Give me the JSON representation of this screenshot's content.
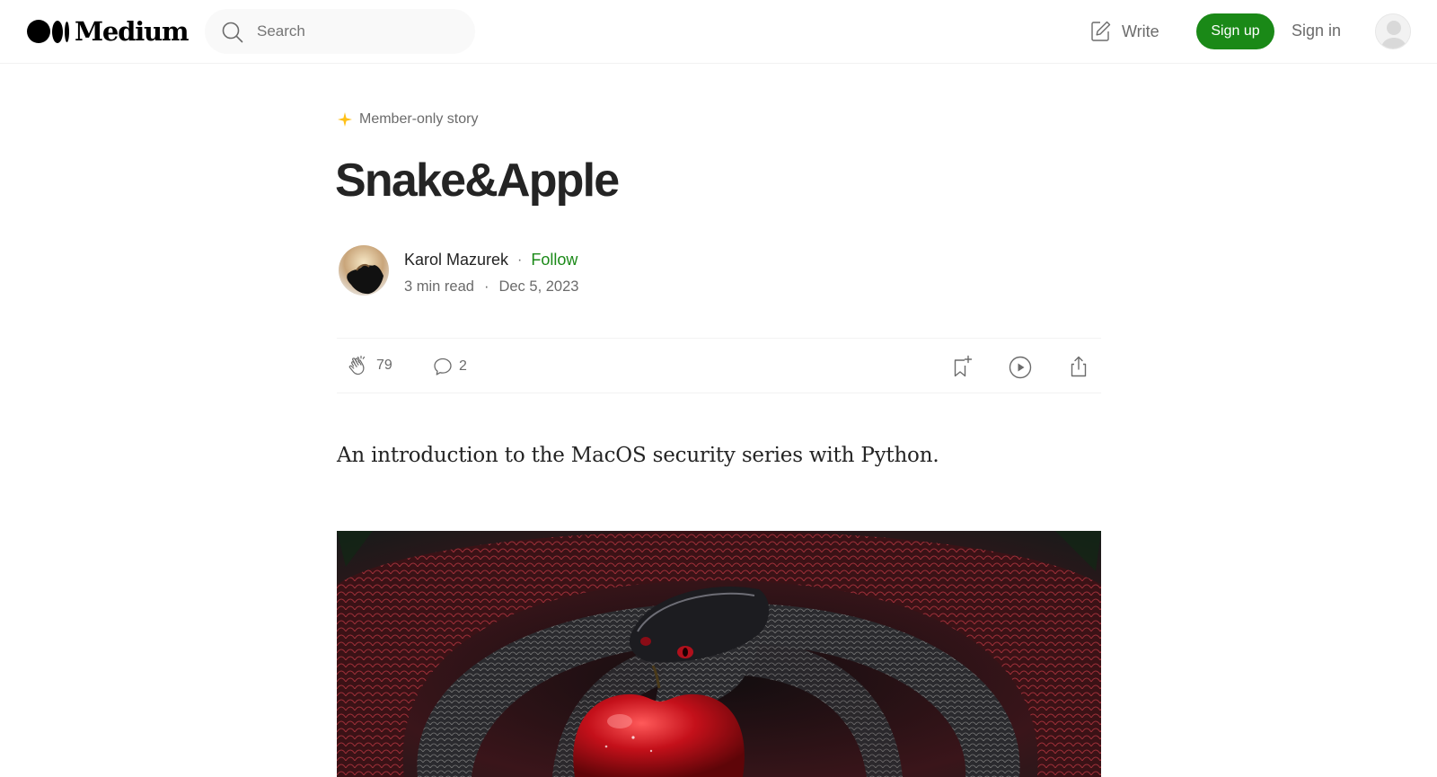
{
  "header": {
    "logo_text": "Medium",
    "search_placeholder": "Search",
    "write_label": "Write",
    "signup_label": "Sign up",
    "signin_label": "Sign in"
  },
  "article": {
    "badge": "Member-only story",
    "title": "Snake&Apple",
    "author": {
      "name": "Karol Mazurek",
      "separator": "·",
      "follow_label": "Follow"
    },
    "meta": {
      "read_time": "3 min read",
      "separator": "·",
      "date": "Dec 5, 2023"
    },
    "actions": {
      "claps": "79",
      "comments": "2"
    },
    "subtitle": "An introduction to the MacOS security series with Python."
  },
  "colors": {
    "brand_green": "#1a8917",
    "member_star": "#ffc017",
    "text_primary": "#242424",
    "text_secondary": "#6b6b6b"
  },
  "icons": [
    "search-icon",
    "write-icon",
    "user-icon",
    "star-icon",
    "clap-icon",
    "comment-icon",
    "bookmark-add-icon",
    "play-icon",
    "share-icon"
  ]
}
